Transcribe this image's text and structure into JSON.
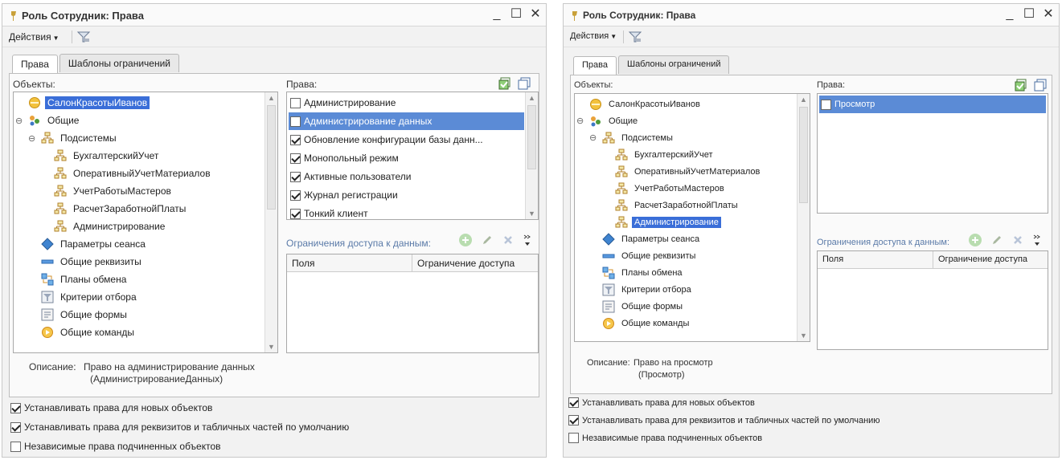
{
  "window_title": "Роль Сотрудник: Права",
  "toolbar": {
    "actions_label": "Действия"
  },
  "tabs": [
    "Права",
    "Шаблоны ограничений"
  ],
  "objects_label": "Объекты:",
  "rights_label": "Права:",
  "restrictions_label": "Ограничения доступа к данным:",
  "grid_columns": [
    "Поля",
    "Ограничение доступа"
  ],
  "description_label": "Описание:",
  "tree": [
    {
      "label": "СалонКрасотыИванов",
      "icon": "config-icon",
      "level": 0,
      "expander": ""
    },
    {
      "label": "Общие",
      "icon": "common-icon",
      "level": 0,
      "expander": "⊖"
    },
    {
      "label": "Подсистемы",
      "icon": "subsystem-icon",
      "level": 1,
      "expander": "⊖"
    },
    {
      "label": "БухгалтерскийУчет",
      "icon": "subsystem-icon",
      "level": 2,
      "expander": ""
    },
    {
      "label": "ОперативныйУчетМатериалов",
      "icon": "subsystem-icon",
      "level": 2,
      "expander": ""
    },
    {
      "label": "УчетРаботыМастеров",
      "icon": "subsystem-icon",
      "level": 2,
      "expander": ""
    },
    {
      "label": "РасчетЗаработнойПлаты",
      "icon": "subsystem-icon",
      "level": 2,
      "expander": ""
    },
    {
      "label": "Администрирование",
      "icon": "subsystem-icon",
      "level": 2,
      "expander": ""
    },
    {
      "label": "Параметры сеанса",
      "icon": "session-params-icon",
      "level": 1,
      "expander": ""
    },
    {
      "label": "Общие реквизиты",
      "icon": "common-attributes-icon",
      "level": 1,
      "expander": ""
    },
    {
      "label": "Планы обмена",
      "icon": "exchange-plans-icon",
      "level": 1,
      "expander": ""
    },
    {
      "label": "Критерии отбора",
      "icon": "filter-criteria-icon",
      "level": 1,
      "expander": ""
    },
    {
      "label": "Общие формы",
      "icon": "common-forms-icon",
      "level": 1,
      "expander": ""
    },
    {
      "label": "Общие команды",
      "icon": "common-commands-icon",
      "level": 1,
      "expander": ""
    }
  ],
  "left": {
    "selected_tree_index": 0,
    "rights": [
      {
        "label": "Администрирование",
        "checked": false,
        "selected": false
      },
      {
        "label": "Администрирование данных",
        "checked": false,
        "selected": true
      },
      {
        "label": "Обновление конфигурации базы данн...",
        "checked": true,
        "selected": false
      },
      {
        "label": "Монопольный режим",
        "checked": true,
        "selected": false
      },
      {
        "label": "Активные пользователи",
        "checked": true,
        "selected": false
      },
      {
        "label": "Журнал регистрации",
        "checked": true,
        "selected": false
      },
      {
        "label": "Тонкий клиент",
        "checked": true,
        "selected": false
      }
    ],
    "description_line1": "Право на администрирование данных",
    "description_line2": "(АдминистрированиеДанных)"
  },
  "right": {
    "selected_tree_index": 7,
    "rights": [
      {
        "label": "Просмотр",
        "checked": false,
        "selected": true
      }
    ],
    "description_line1": "Право на просмотр",
    "description_line2": "(Просмотр)"
  },
  "options": [
    {
      "label": "Устанавливать права для новых объектов",
      "checked": true
    },
    {
      "label": "Устанавливать права для реквизитов и табличных частей по умолчанию",
      "checked": true
    },
    {
      "label": "Независимые права подчиненных объектов",
      "checked": false
    }
  ]
}
